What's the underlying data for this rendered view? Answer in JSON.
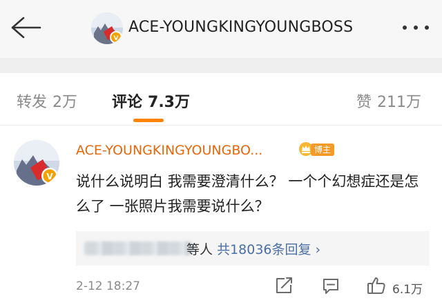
{
  "header": {
    "title": "ACE-YOUNGKINGYOUNGBOSS",
    "back_icon": "back-arrow-icon",
    "more_icon": "more-dots-icon"
  },
  "tabs": {
    "repost_label": "转发",
    "repost_count": "2万",
    "comment_label": "评论",
    "comment_count": "7.3万",
    "like_label": "赞",
    "like_count": "211万",
    "active_color": "#ff8200"
  },
  "comment": {
    "author": "ACE-YOUNGKINGYOUNGBO...",
    "author_color": "#e8660a",
    "verified_badge": "V",
    "host_tag": "博主",
    "text": "说什么说明白 我需要澄清什么？ 一个个幻想症还是怎么了 一张照片我需要说什么？",
    "replies": {
      "prefix": "等人",
      "count_text": "共18036条回复",
      "chevron": "›"
    },
    "time": "2-12 18:27",
    "like_count": "6.1万"
  }
}
